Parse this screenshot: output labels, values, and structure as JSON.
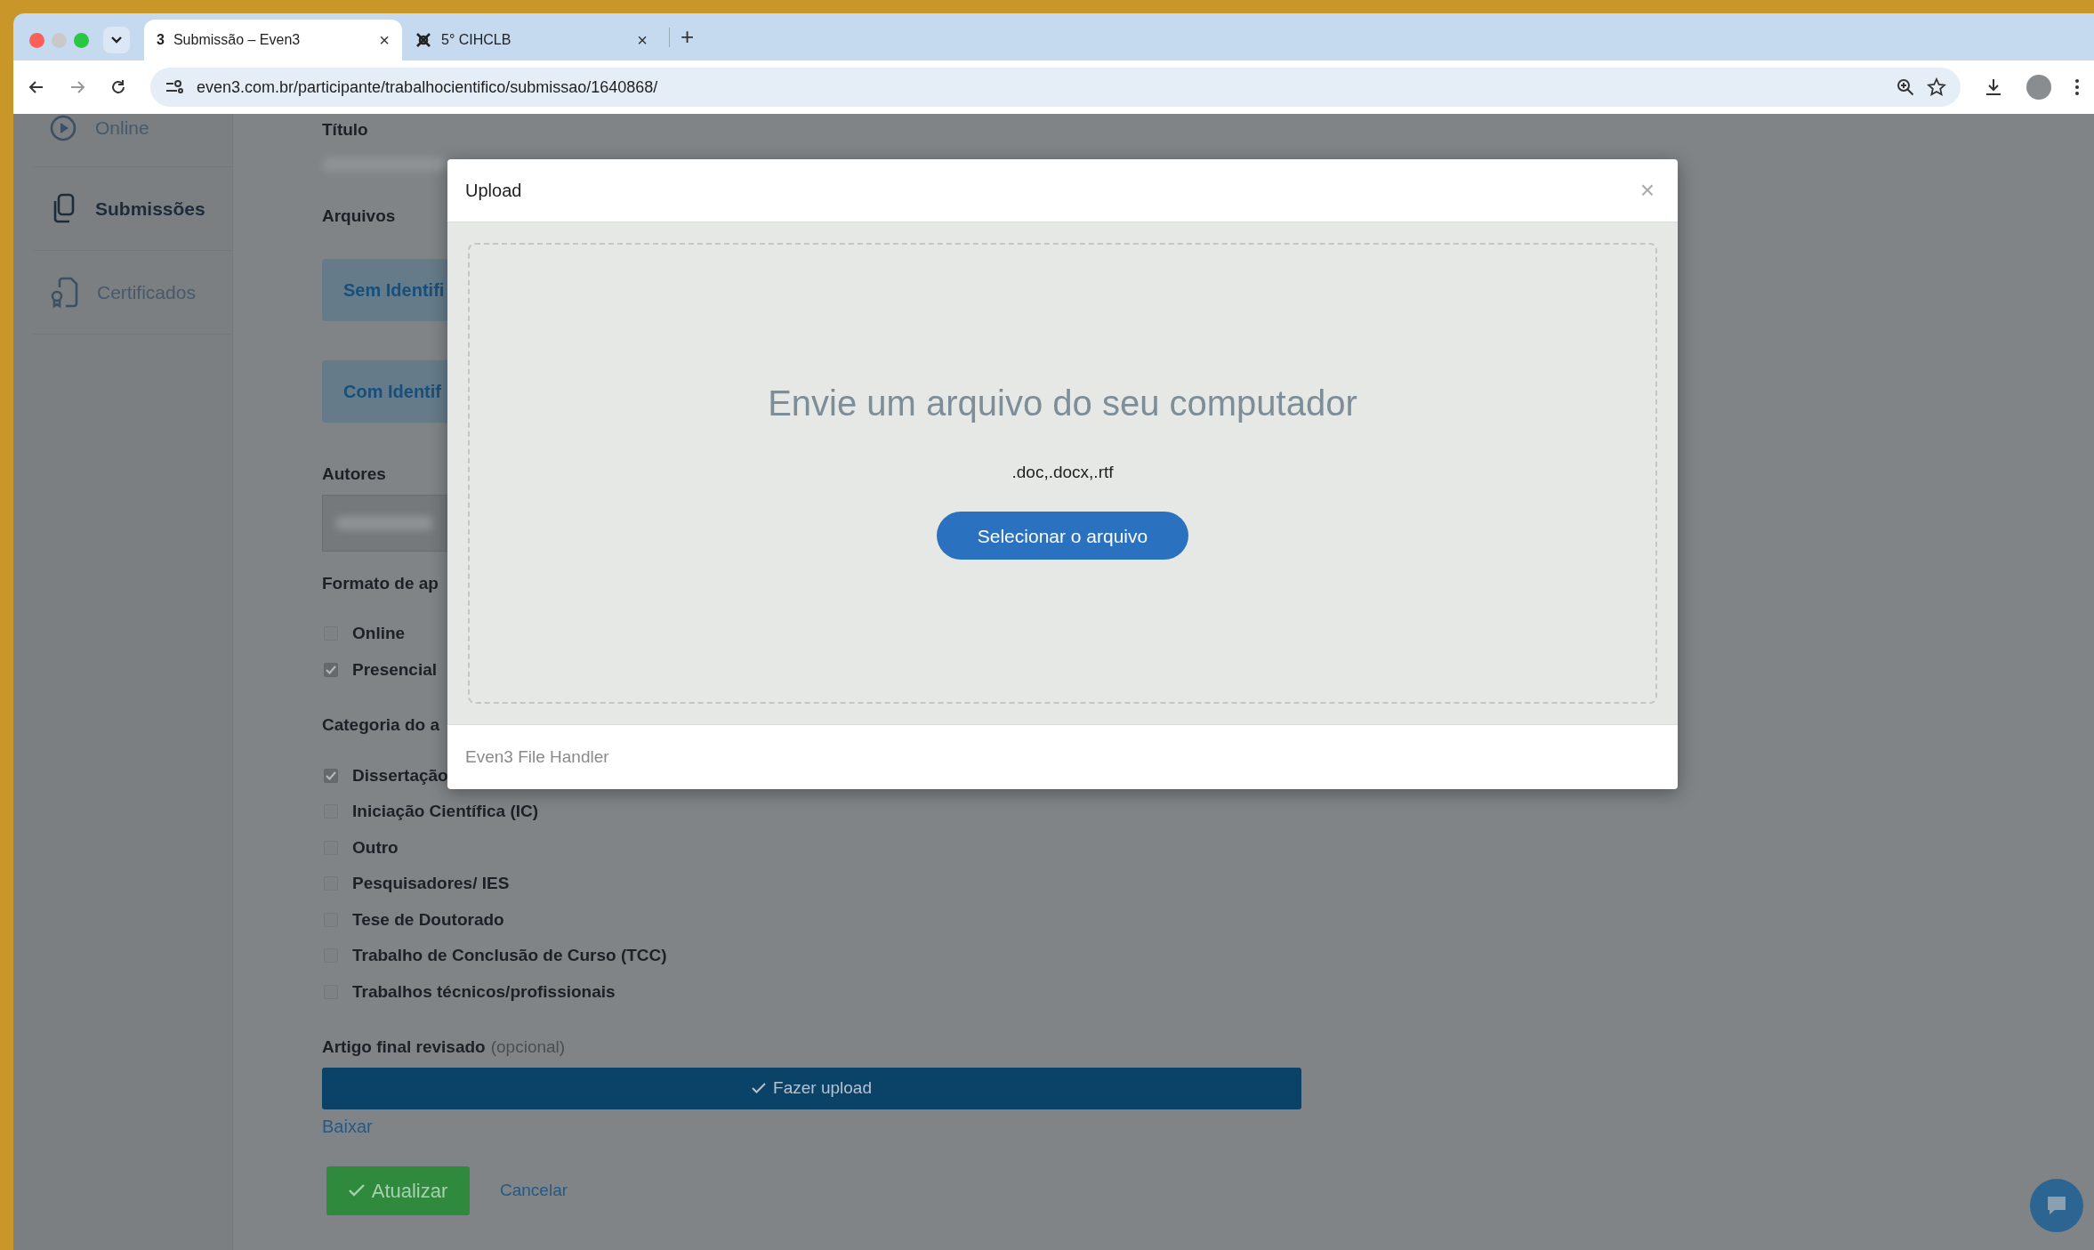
{
  "browser": {
    "tabs": [
      {
        "favicon_text": "3",
        "title": "Submissão – Even3",
        "close": "×",
        "selected": true
      },
      {
        "title": "5° CIHCLB",
        "close": "×",
        "selected": false
      }
    ],
    "new_tab": "+",
    "url": "even3.com.br/participante/trabalhocientifico/submissao/1640868/"
  },
  "sidebar": {
    "items": [
      {
        "label": "Online",
        "kind": "online",
        "selected": false
      },
      {
        "label": "Submissões",
        "kind": "submissions",
        "selected": true
      },
      {
        "label": "Certificados",
        "kind": "certificates",
        "selected": false
      }
    ]
  },
  "form": {
    "title_label": "Título",
    "files_label": "Arquivos",
    "file_buttons": [
      "Sem Identifi",
      "Com Identif"
    ],
    "authors_label": "Autores",
    "format_label": "Formato de ap",
    "format_options": [
      {
        "label": "Online",
        "checked": false
      },
      {
        "label": "Presencial",
        "checked": true
      }
    ],
    "category_label": "Categoria do a",
    "category_options": [
      {
        "label": "Dissertação",
        "checked": true
      },
      {
        "label": "Iniciação Científica (IC)",
        "checked": false
      },
      {
        "label": "Outro",
        "checked": false
      },
      {
        "label": "Pesquisadores/ IES",
        "checked": false
      },
      {
        "label": "Tese de Doutorado",
        "checked": false
      },
      {
        "label": "Trabalho de Conclusão de Curso (TCC)",
        "checked": false
      },
      {
        "label": "Trabalhos técnicos/profissionais",
        "checked": false
      }
    ],
    "final_article_label": "Artigo final revisado",
    "final_article_hint": "(opcional)",
    "upload_button": "Fazer upload",
    "download_link": "Baixar",
    "submit_button": "Atualizar",
    "cancel_link": "Cancelar"
  },
  "modal": {
    "title": "Upload",
    "close": "×",
    "heading": "Envie um arquivo do seu computador",
    "extensions": ".doc,.docx,.rtf",
    "select_button": "Selecionar o arquivo",
    "footer": "Even3 File Handler"
  }
}
